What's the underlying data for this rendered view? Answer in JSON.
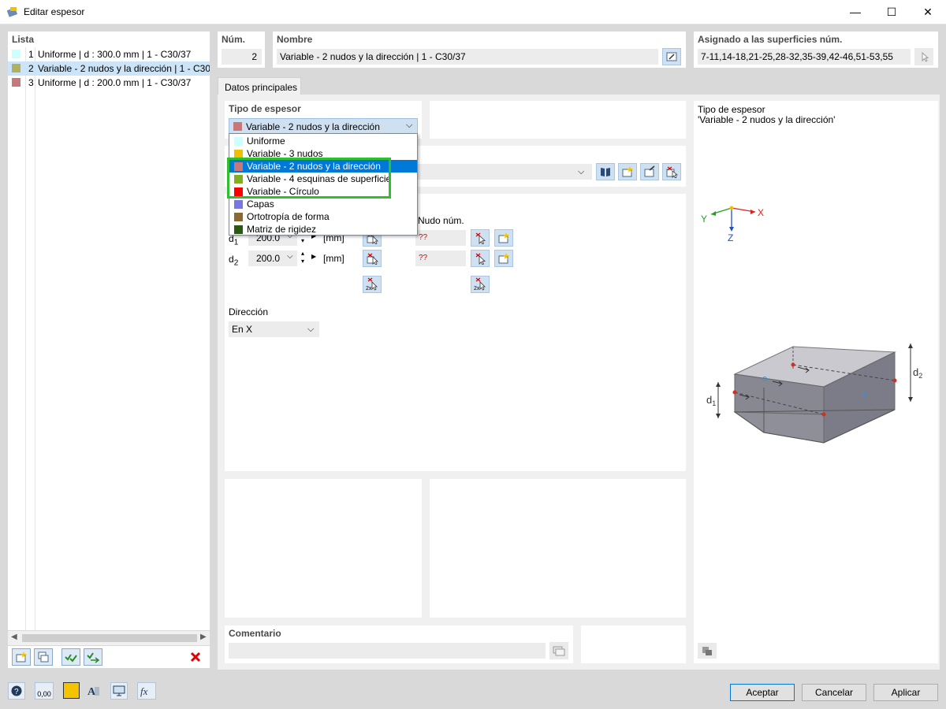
{
  "window": {
    "title": "Editar espesor",
    "minimize": "—",
    "maximize": "☐",
    "close": "✕"
  },
  "list": {
    "header": "Lista",
    "items": [
      {
        "num": "1",
        "label": "Uniforme | d : 300.0 mm | 1 - C30/37",
        "color": "#ccffff"
      },
      {
        "num": "2",
        "label": "Variable - 2 nudos y la dirección | 1 - C30/37",
        "color": "#b0b060"
      },
      {
        "num": "3",
        "label": "Uniforme | d : 200.0 mm | 1 - C30/37",
        "color": "#c87878"
      }
    ]
  },
  "num": {
    "label": "Núm.",
    "value": "2"
  },
  "nombre": {
    "label": "Nombre",
    "value": "Variable - 2 nudos y la dirección | 1 - C30/37"
  },
  "asignado": {
    "label": "Asignado a las superficies núm.",
    "value": "7-11,14-18,21-25,28-32,35-39,42-46,51-53,55"
  },
  "tab": {
    "label": "Datos principales"
  },
  "tipo": {
    "label": "Tipo de espesor",
    "selected": "Variable - 2 nudos y la dirección",
    "selected_color": "#c87878",
    "options": [
      {
        "label": "Uniforme",
        "color": "#ccffff"
      },
      {
        "label": "Variable - 3 nudos",
        "color": "#f0c000"
      },
      {
        "label": "Variable - 2 nudos y la dirección",
        "color": "#c87878"
      },
      {
        "label": "Variable - 4 esquinas de superficie",
        "color": "#80b020"
      },
      {
        "label": "Variable - Círculo",
        "color": "#ff0000"
      },
      {
        "label": "Capas",
        "color": "#7878e0"
      },
      {
        "label": "Ortotropía de forma",
        "color": "#8a6a30"
      },
      {
        "label": "Matriz de rigidez",
        "color": "#2a5a10"
      }
    ]
  },
  "thickness": {
    "nudo_label": "Nudo núm.",
    "rows": [
      {
        "label": "d1",
        "value": "200.0",
        "unit": "[mm]",
        "node": "??"
      },
      {
        "label": "d2",
        "value": "200.0",
        "unit": "[mm]",
        "node": "??"
      }
    ]
  },
  "direccion": {
    "label": "Dirección",
    "value": "En X"
  },
  "preview": {
    "title": "Tipo de espesor",
    "subtitle": "'Variable - 2 nudos y la dirección'",
    "axis_x": "X",
    "axis_y": "Y",
    "axis_z": "Z",
    "d1": "d1",
    "d2": "d2"
  },
  "comentario": {
    "label": "Comentario",
    "value": ""
  },
  "buttons": {
    "accept": "Aceptar",
    "cancel": "Cancelar",
    "apply": "Aplicar"
  },
  "statusbar": {
    "units": "0,00"
  }
}
